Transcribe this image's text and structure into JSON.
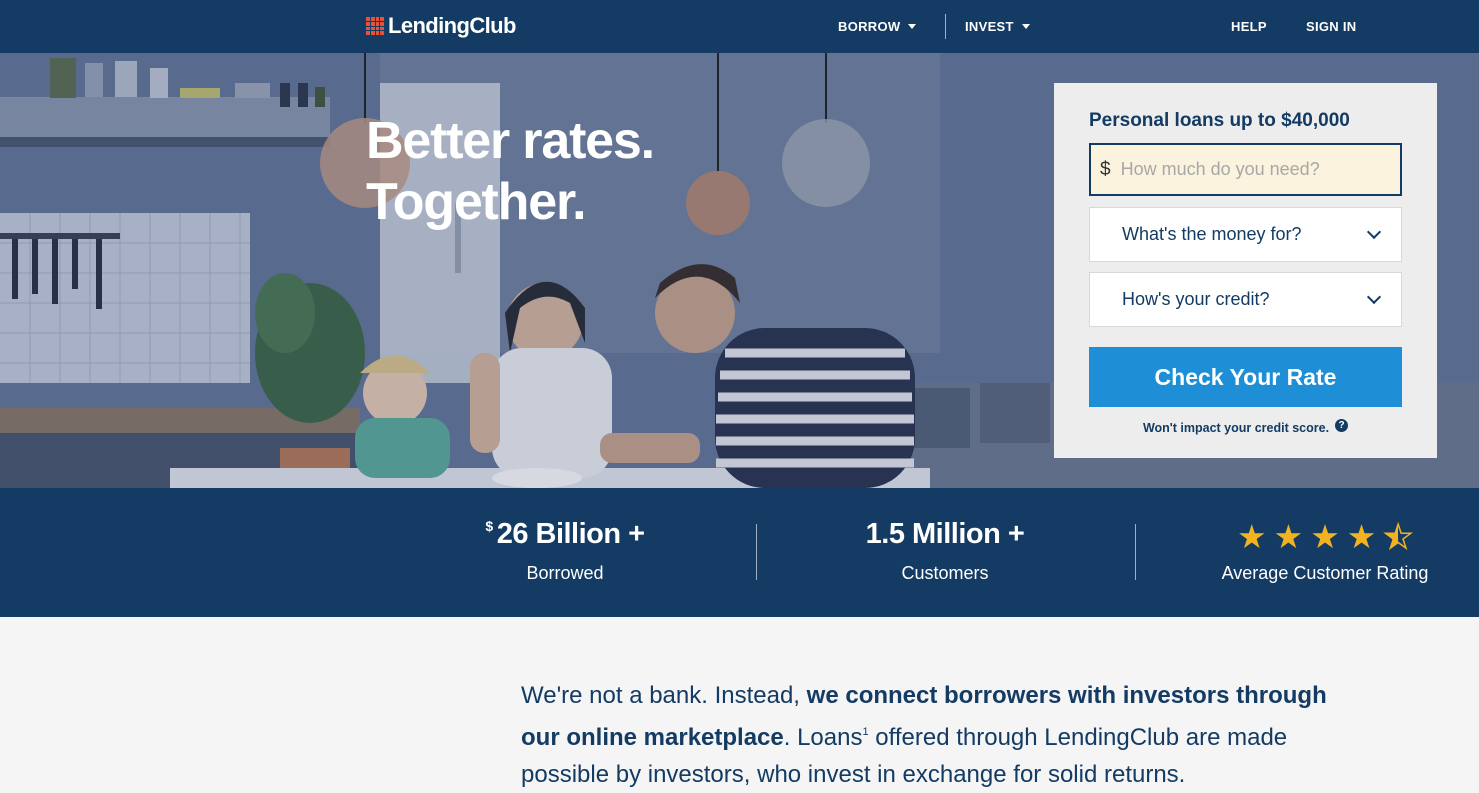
{
  "nav": {
    "logo_text": "LendingClub",
    "borrow": "BORROW",
    "invest": "INVEST",
    "help": "HELP",
    "sign_in": "SIGN IN"
  },
  "hero": {
    "headline_line1": "Better rates.",
    "headline_line2": "Together."
  },
  "loan_card": {
    "title": "Personal loans up to $40,000",
    "currency_symbol": "$",
    "amount_placeholder": "How much do you need?",
    "amount_value": "",
    "purpose_select": "What's the money for?",
    "credit_select": "How's your credit?",
    "cta": "Check Your Rate",
    "fine_print": "Won't impact your credit score.",
    "help_icon_glyph": "?"
  },
  "stats": [
    {
      "prefix": "$",
      "value": "26 Billion +",
      "label": "Borrowed"
    },
    {
      "prefix": "",
      "value": "1.5 Million +",
      "label": "Customers"
    },
    {
      "rating": 4.5,
      "max": 5,
      "label": "Average Customer Rating"
    }
  ],
  "intro": {
    "part1": "We're not a bank. Instead, ",
    "bold": "we connect borrowers with investors through our online marketplace",
    "part2": ". Loans",
    "footnote": "1",
    "part3": " offered through LendingClub are made possible by investors, who invest in exchange for solid returns."
  },
  "colors": {
    "navy": "#133b63",
    "cta_blue": "#1e8fd6",
    "star_gold": "#f2b322",
    "logo_red": "#e5533b",
    "input_highlight": "#fcf3de"
  }
}
